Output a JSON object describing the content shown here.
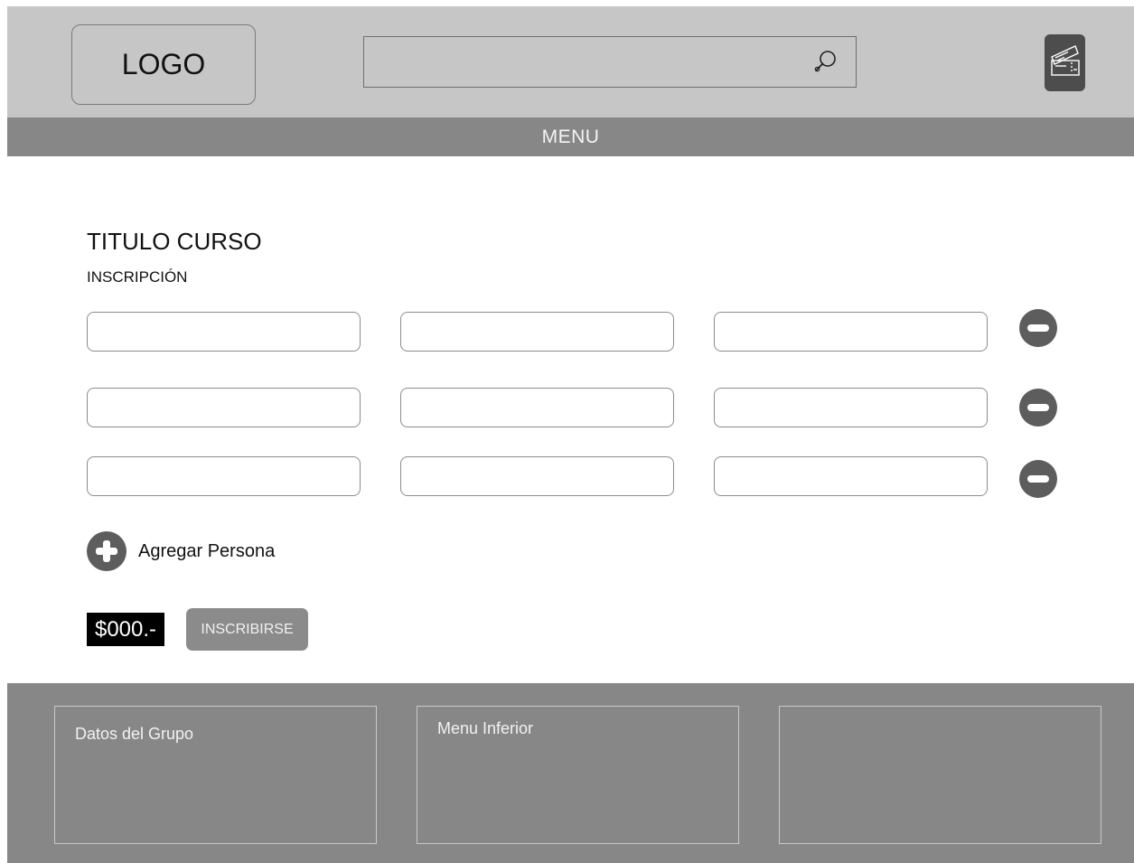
{
  "header": {
    "logo_text": "LOGO",
    "search": {
      "value": "",
      "placeholder": ""
    },
    "search_icon": "search-icon",
    "tickets_icon": "tickets-icon"
  },
  "menu": {
    "label": "MENU"
  },
  "main": {
    "course_title": "TITULO CURSO",
    "section_label": "INSCRIPCIÓN",
    "rows": [
      {
        "fields": [
          "",
          "",
          ""
        ],
        "remove_icon": "minus-circle-icon"
      },
      {
        "fields": [
          "",
          "",
          ""
        ],
        "remove_icon": "minus-circle-icon"
      },
      {
        "fields": [
          "",
          "",
          ""
        ],
        "remove_icon": "minus-circle-icon"
      }
    ],
    "add_person": {
      "label": "Agregar Persona",
      "icon": "plus-circle-icon"
    },
    "price": "$000.-",
    "subscribe_label": "INSCRIBIRSE"
  },
  "footer": {
    "boxes": [
      {
        "label": "Datos del Grupo"
      },
      {
        "label": "Menu Inferior"
      },
      {
        "label": ""
      }
    ]
  },
  "colors": {
    "header_bg": "#c6c6c6",
    "menu_bg": "#878787",
    "footer_bg": "#878787",
    "icon_dark": "#5d5d5d",
    "button_bg": "#8b8b8b",
    "price_bg": "#000000"
  }
}
